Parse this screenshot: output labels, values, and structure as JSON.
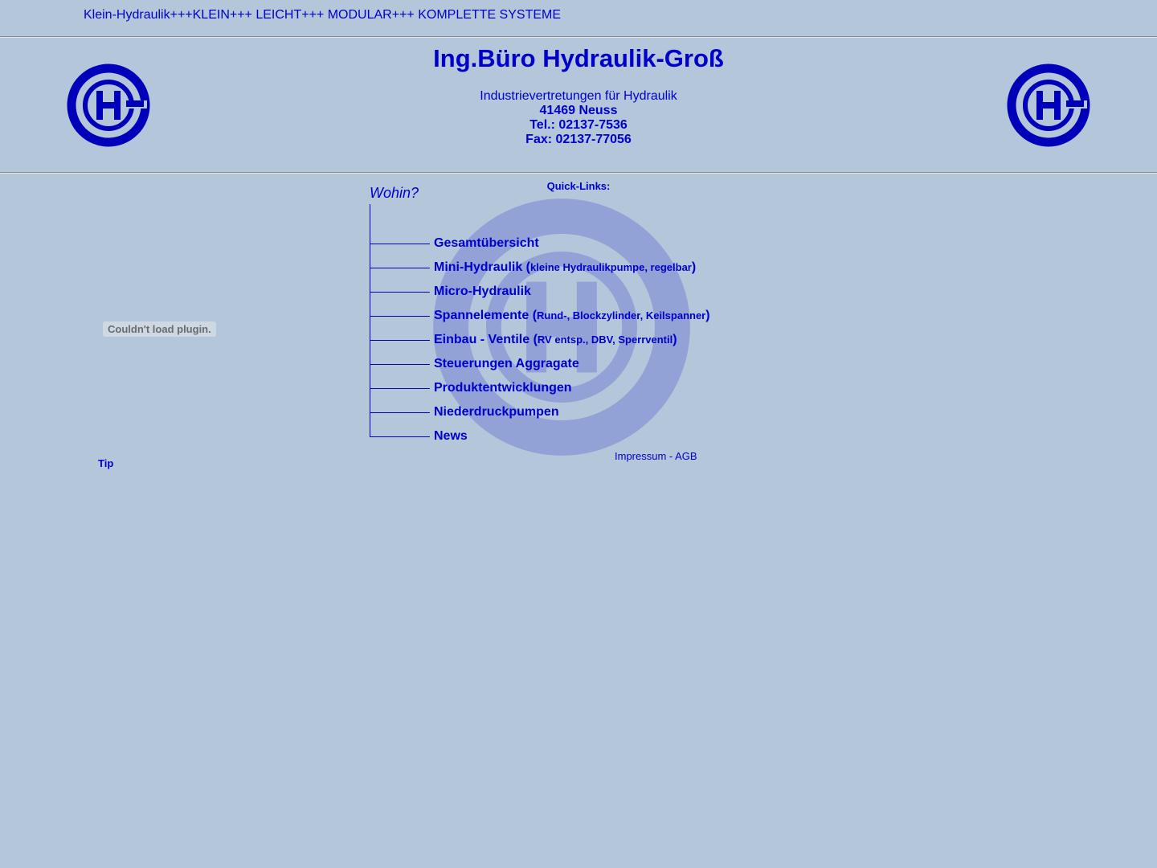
{
  "ticker": {
    "text": "Klein-Hydraulik+++KLEIN+++ LEICHT+++ MODULAR+++ KOMPLETTE SYSTEME"
  },
  "header": {
    "title": "Ing.Büro Hydraulik-Groß",
    "subtitle": "Industrievertretungen für Hydraulik",
    "city": "41469 Neuss",
    "phone": "Tel.: 02137-7536",
    "fax": "Fax: 02137-77056"
  },
  "plugin": {
    "message": "Couldn't load plugin."
  },
  "tip": {
    "label": "Tip"
  },
  "quick_links": {
    "heading": "Quick-Links:",
    "wohin": "Wohin?",
    "items": [
      {
        "label": "Gesamtübersicht",
        "detail": ""
      },
      {
        "label": "Mini-Hydraulik (",
        "detail": "kleine Hydraulikpumpe, regelbar",
        "close": ")"
      },
      {
        "label": "Micro-Hydraulik",
        "detail": ""
      },
      {
        "label": "Spannelemente (",
        "detail": "Rund-, Blockzylinder, Keilspanner",
        "close": ")"
      },
      {
        "label": "Einbau - Ventile (",
        "detail": "RV entsp., DBV, Sperrventil",
        "close": ")"
      },
      {
        "label": "Steuerungen Aggragate",
        "detail": ""
      },
      {
        "label": "Produktentwicklungen",
        "detail": ""
      },
      {
        "label": "Niederdruckpumpen",
        "detail": ""
      },
      {
        "label": "News",
        "detail": ""
      }
    ]
  },
  "footer": {
    "impressum": "Impressum",
    "separator": " - ",
    "agb": "AGB"
  },
  "colors": {
    "background": "#b4c6d9",
    "link": "#0000cc"
  },
  "icons": {
    "logo": "hg-logo-icon"
  }
}
